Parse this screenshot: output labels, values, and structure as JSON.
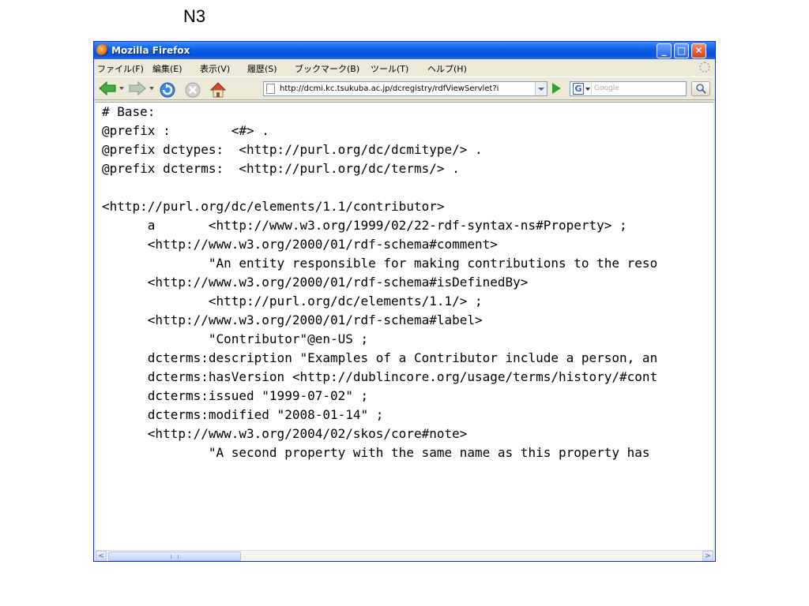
{
  "slide": {
    "title": "N3"
  },
  "window": {
    "title": "Mozilla Firefox",
    "buttons": {
      "minimize": "_",
      "maximize": "□",
      "close": "✕"
    }
  },
  "menubar": {
    "items": [
      {
        "label": "ファイル(F)"
      },
      {
        "label": "編集(E)"
      },
      {
        "label": "表示(V)"
      },
      {
        "label": "履歴(S)"
      },
      {
        "label": "ブックマーク(B)"
      },
      {
        "label": "ツール(T)"
      },
      {
        "label": "ヘルプ(H)"
      }
    ]
  },
  "navbar": {
    "url": "http://dcmi.kc.tsukuba.ac.jp/dcregistry/rdfViewServlet?i",
    "search_placeholder": "Google"
  },
  "content": {
    "lines": [
      "# Base:",
      "@prefix :        <#> .",
      "@prefix dctypes:  <http://purl.org/dc/dcmitype/> .",
      "@prefix dcterms:  <http://purl.org/dc/terms/> .",
      "",
      "<http://purl.org/dc/elements/1.1/contributor>",
      "      a       <http://www.w3.org/1999/02/22-rdf-syntax-ns#Property> ;",
      "      <http://www.w3.org/2000/01/rdf-schema#comment>",
      "              \"An entity responsible for making contributions to the reso",
      "      <http://www.w3.org/2000/01/rdf-schema#isDefinedBy>",
      "              <http://purl.org/dc/elements/1.1/> ;",
      "      <http://www.w3.org/2000/01/rdf-schema#label>",
      "              \"Contributor\"@en-US ;",
      "      dcterms:description \"Examples of a Contributor include a person, an",
      "      dcterms:hasVersion <http://dublincore.org/usage/terms/history/#cont",
      "      dcterms:issued \"1999-07-02\" ;",
      "      dcterms:modified \"2008-01-14\" ;",
      "      <http://www.w3.org/2004/02/skos/core#note>",
      "              \"A second property with the same name as this property has"
    ]
  },
  "scrollbar": {
    "left_arrow": "<",
    "right_arrow": ">"
  }
}
